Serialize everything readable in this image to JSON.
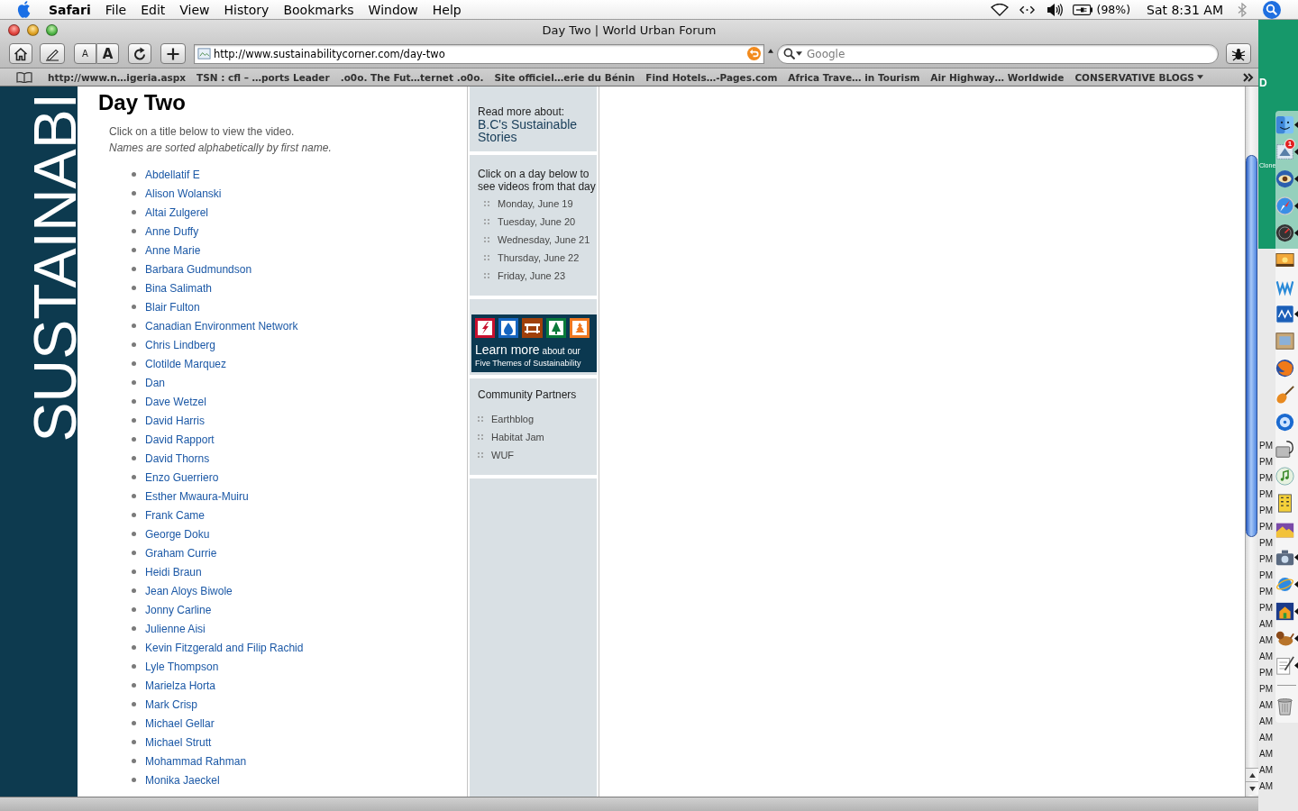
{
  "menu_bar": {
    "app": "Safari",
    "menus": [
      "File",
      "Edit",
      "View",
      "History",
      "Bookmarks",
      "Window",
      "Help"
    ],
    "battery": "(98%)",
    "clock": "Sat 8:31 AM"
  },
  "window": {
    "title": "Day Two | World Urban Forum"
  },
  "toolbar": {
    "text_size": [
      "A",
      "A"
    ],
    "address": "http://www.sustainabilitycorner.com/day-two",
    "search": {
      "placeholder": "Google"
    }
  },
  "bookmarks": [
    {
      "label": "http://www.n…igeria.aspx",
      "kind": "link"
    },
    {
      "label": "TSN : cfl – …ports Leader",
      "kind": "link"
    },
    {
      "label": ".o0o. The Fut…ternet .o0o.",
      "kind": "link"
    },
    {
      "label": "Site officiel…erie du Bénin",
      "kind": "link"
    },
    {
      "label": "Find Hotels…-Pages.com",
      "kind": "link"
    },
    {
      "label": "Africa Trave… in Tourism",
      "kind": "link"
    },
    {
      "label": "Air Highway… Worldwide",
      "kind": "link"
    },
    {
      "label": "CONSERVATIVE BLOGS",
      "kind": "folder"
    }
  ],
  "page": {
    "logo": "SUSTAINABI",
    "heading": "Day Two",
    "intro": "Click on a title below to view the video.",
    "note": "Names are sorted alphabetically by first name.",
    "videos": [
      "Abdellatif E",
      "Alison Wolanski",
      "Altai Zulgerel",
      "Anne Duffy",
      "Anne Marie",
      "Barbara Gudmundson",
      "Bina Salimath",
      "Blair Fulton",
      "Canadian Environment Network",
      "Chris Lindberg",
      "Clotilde Marquez",
      "Dan",
      "Dave Wetzel",
      "David Harris",
      "David Rapport",
      "David Thorns",
      "Enzo Guerriero",
      "Esther Mwaura-Muiru",
      "Frank Came",
      "George Doku",
      "Graham Currie",
      "Heidi Braun",
      "Jean Aloys Biwole",
      "Jonny Carline",
      "Julienne Aisi",
      "Kevin Fitzgerald and Filip Rachid",
      "Lyle Thompson",
      "Marielza Horta",
      "Mark Crisp",
      "Michael Gellar",
      "Michael Strutt",
      "Mohammad Rahman",
      "Monika Jaeckel"
    ]
  },
  "side_column": {
    "read_more": {
      "label": "Read more about:",
      "link": "B.C's Sustainable Stories"
    },
    "days": {
      "prompt": "Click on a day below to see videos from that day",
      "items": [
        "Monday, June 19",
        "Tuesday, June 20",
        "Wednesday, June 21",
        "Thursday, June 22",
        "Friday, June 23"
      ]
    },
    "banner": {
      "heading": "Learn more",
      "lead": "about our",
      "subtitle": "Five Themes of Sustainability"
    },
    "partners": {
      "title": "Community Partners",
      "items": [
        "Earthblog",
        "Habitat Jam",
        "WUF"
      ]
    }
  },
  "desktop": {
    "corner_text": "D",
    "icon_label": "Clone"
  },
  "background_window": {
    "times": [
      "PM",
      "PM",
      "PM",
      "PM",
      "PM",
      "PM",
      "PM",
      "PM",
      "PM",
      "PM",
      "PM",
      "AM",
      "AM",
      "AM",
      "PM",
      "PM",
      "AM",
      "AM",
      "AM",
      "AM",
      "AM",
      "AM"
    ]
  },
  "dock": {
    "items": [
      {
        "running": true
      },
      {
        "running": true,
        "badge": "1"
      },
      {
        "running": true
      },
      {
        "running": true
      },
      {
        "running": true
      },
      {
        "running": false
      },
      {
        "running": false
      },
      {
        "running": true
      },
      {
        "running": false
      },
      {
        "running": false
      },
      {
        "running": false
      },
      {
        "running": false
      },
      {
        "running": false
      },
      {
        "running": false
      },
      {
        "running": false
      },
      {
        "running": false
      },
      {
        "running": true
      },
      {
        "running": true
      },
      {
        "running": true
      },
      {
        "running": true
      },
      {
        "running": true
      },
      {
        "running": false
      }
    ]
  }
}
